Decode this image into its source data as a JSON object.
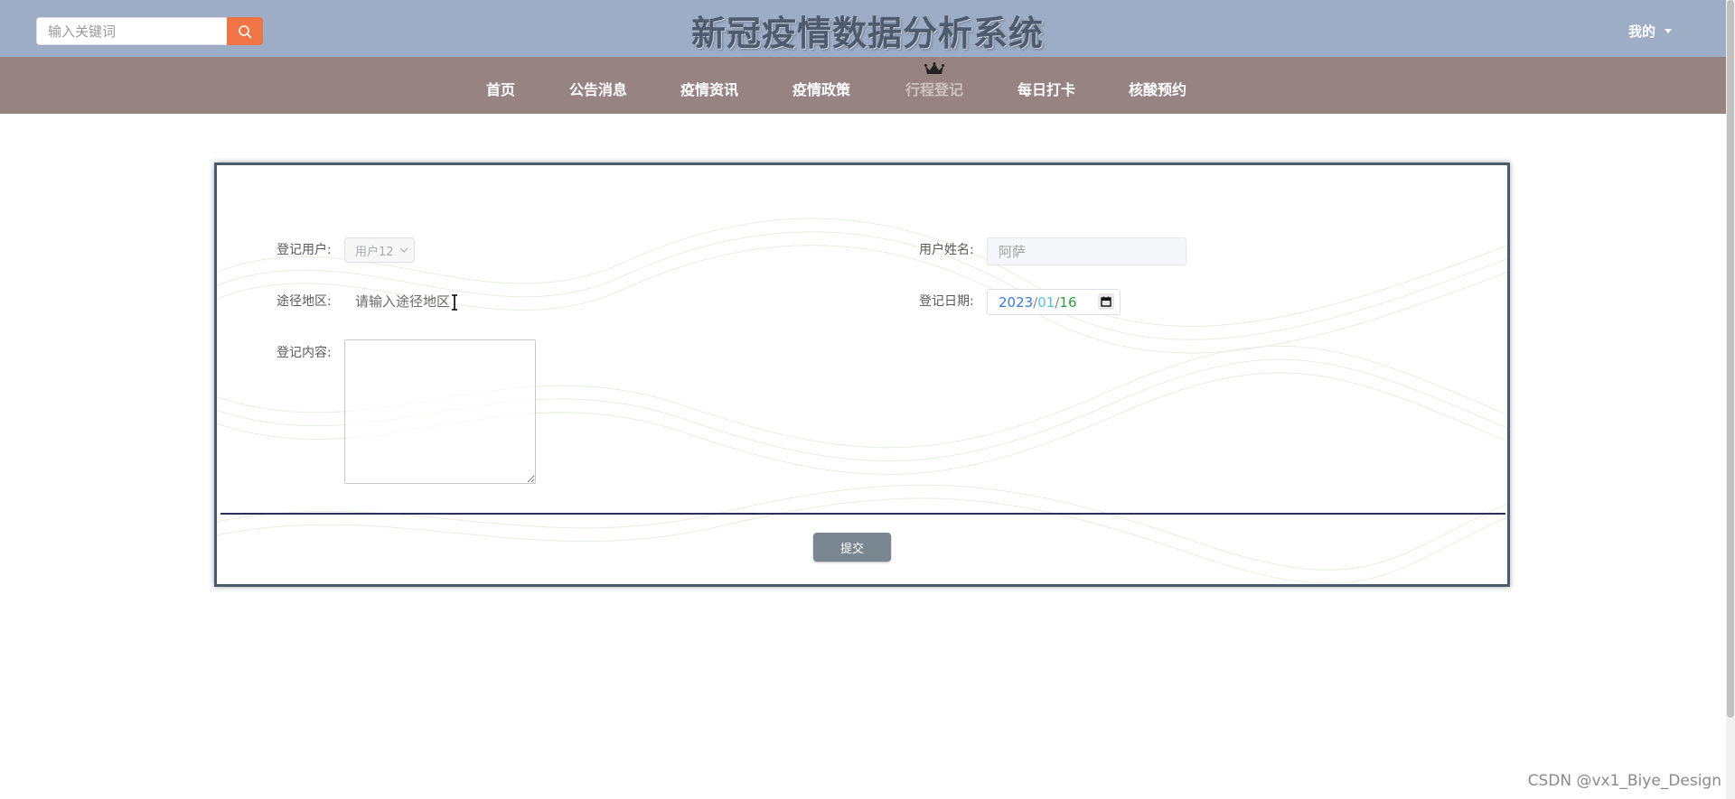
{
  "header": {
    "search_placeholder": "输入关键词",
    "site_title": "新冠疫情数据分析系统",
    "user_menu_label": "我的"
  },
  "nav": {
    "items": [
      {
        "label": "首页"
      },
      {
        "label": "公告消息"
      },
      {
        "label": "疫情资讯"
      },
      {
        "label": "疫情政策"
      },
      {
        "label": "行程登记",
        "active": true
      },
      {
        "label": "每日打卡"
      },
      {
        "label": "核酸预约"
      }
    ]
  },
  "form": {
    "user_label": "登记用户:",
    "user_value": "用户12",
    "name_label": "用户姓名:",
    "name_value": "阿萨",
    "route_label": "途径地区:",
    "route_placeholder": "请输入途径地区",
    "date_label": "登记日期:",
    "date_year": "2023",
    "date_month": "01",
    "date_day": "16",
    "content_label": "登记内容:",
    "submit_label": "提交"
  },
  "watermark": "CSDN @vx1_Biye_Design",
  "colors": {
    "topbar": "#9eadc6",
    "navbar": "#978381",
    "search_button": "#ef7547",
    "submit_button": "#7b8790"
  }
}
